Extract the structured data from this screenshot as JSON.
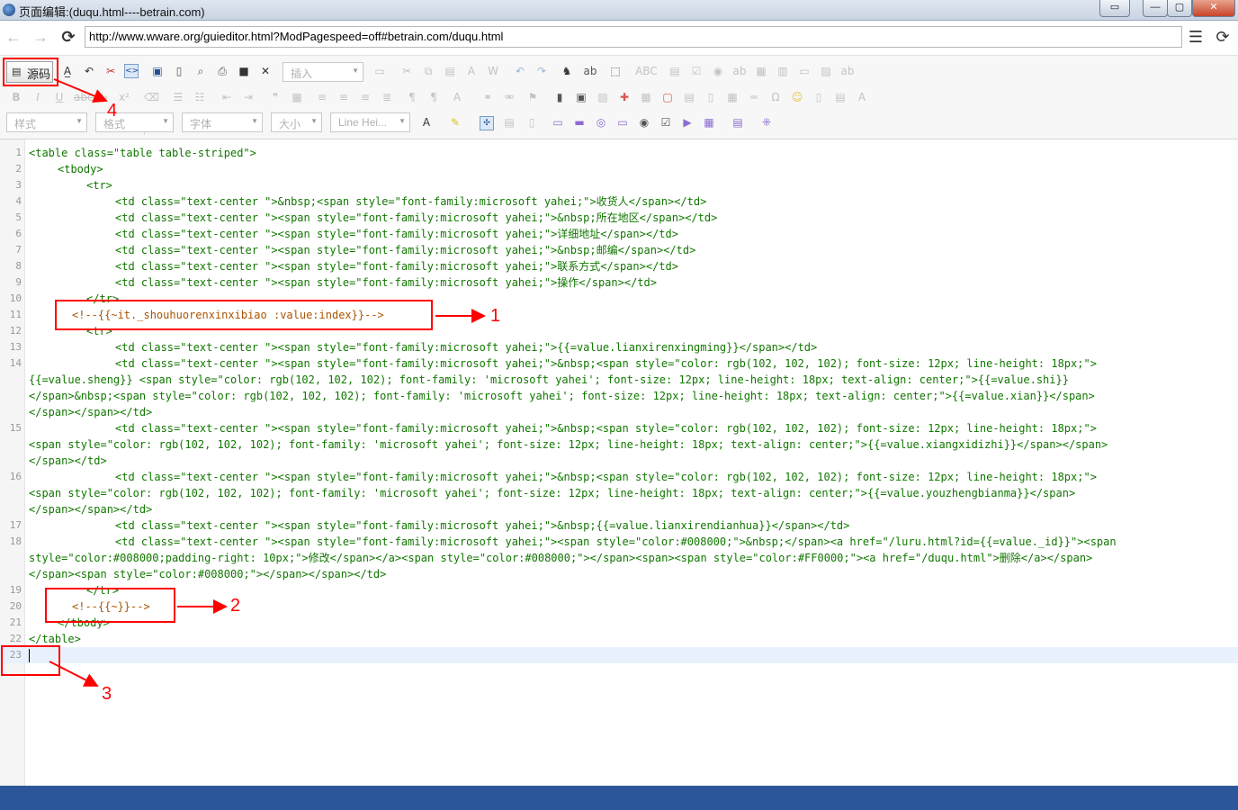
{
  "window": {
    "title": "页面编辑:(duqu.html----betrain.com)",
    "buttons": {
      "restore_back": "▭",
      "minimize": "—",
      "maximize": "▢",
      "close": "✕"
    }
  },
  "nav": {
    "url": "http://www.wware.org/guieditor.html?ModPagespeed=off#betrain.com/duqu.html",
    "back_icon": "←",
    "forward_icon": "→",
    "reload_icon": "⟳",
    "menu_icon": "☰"
  },
  "toolbar": {
    "source_label": "源码",
    "insert_placeholder": "插入",
    "styles_placeholder": "样式",
    "format_placeholder": "格式",
    "font_placeholder": "字体",
    "size_placeholder": "大小",
    "lineheight_placeholder": "Line Hei..."
  },
  "annotations": [
    "1",
    "2",
    "3",
    "4"
  ],
  "code_lines": [
    {
      "n": "1"
    },
    {
      "n": "2"
    },
    {
      "n": "3"
    },
    {
      "n": "4"
    },
    {
      "n": "5"
    },
    {
      "n": "6"
    },
    {
      "n": "7"
    },
    {
      "n": "8"
    },
    {
      "n": "9"
    },
    {
      "n": "10"
    },
    {
      "n": "11"
    },
    {
      "n": "12"
    },
    {
      "n": "13"
    },
    {
      "n": "14"
    },
    {
      "n": "15"
    },
    {
      "n": "16"
    },
    {
      "n": "17"
    },
    {
      "n": "18"
    },
    {
      "n": "19"
    },
    {
      "n": "20"
    },
    {
      "n": "21"
    },
    {
      "n": "22"
    },
    {
      "n": "23"
    }
  ],
  "code": {
    "l1": "<table class=\"table table-striped\">",
    "l2": "<tbody>",
    "l3": "<tr>",
    "l4": "<td class=\"text-center \">&nbsp;<span style=\"font-family:microsoft yahei;\">收货人</span></td>",
    "l5": "<td class=\"text-center \"><span style=\"font-family:microsoft yahei;\">&nbsp;所在地区</span></td>",
    "l6": "<td class=\"text-center \"><span style=\"font-family:microsoft yahei;\">详细地址</span></td>",
    "l7": "<td class=\"text-center \"><span style=\"font-family:microsoft yahei;\">&nbsp;邮编</span></td>",
    "l8": "<td class=\"text-center \"><span style=\"font-family:microsoft yahei;\">联系方式</span></td>",
    "l9": "<td class=\"text-center \"><span style=\"font-family:microsoft yahei;\">操作</span></td>",
    "l10": "</tr>",
    "l11": "<!--{{~it._shouhuorenxinxibiao :value:index}}-->",
    "l12": "<tr>",
    "l13": "<td class=\"text-center \"><span style=\"font-family:microsoft yahei;\">{{=value.lianxirenxingming}}</span></td>",
    "l14a": "<td class=\"text-center \"><span style=\"font-family:microsoft yahei;\">&nbsp;<span style=\"color: rgb(102, 102, 102); font-size: 12px; line-height: 18px;\">",
    "l14b": "{{=value.sheng}} <span style=\"color: rgb(102, 102, 102); font-family: 'microsoft yahei'; font-size: 12px; line-height: 18px; text-align: center;\">{{=value.shi}}",
    "l14c": "</span>&nbsp;<span style=\"color: rgb(102, 102, 102); font-family: 'microsoft yahei'; font-size: 12px; line-height: 18px; text-align: center;\">{{=value.xian}}</span>",
    "l14d": "</span></span></td>",
    "l15a": "<td class=\"text-center \"><span style=\"font-family:microsoft yahei;\">&nbsp;<span style=\"color: rgb(102, 102, 102); font-size: 12px; line-height: 18px;\">",
    "l15b": "<span style=\"color: rgb(102, 102, 102); font-family: 'microsoft yahei'; font-size: 12px; line-height: 18px; text-align: center;\">{{=value.xiangxidizhi}}</span></span>",
    "l15c": "</span></td>",
    "l16a": "<td class=\"text-center \"><span style=\"font-family:microsoft yahei;\">&nbsp;<span style=\"color: rgb(102, 102, 102); font-size: 12px; line-height: 18px;\">",
    "l16b": "<span style=\"color: rgb(102, 102, 102); font-family: 'microsoft yahei'; font-size: 12px; line-height: 18px; text-align: center;\">{{=value.youzhengbianma}}</span>",
    "l16c": "</span></span></td>",
    "l17": "<td class=\"text-center \"><span style=\"font-family:microsoft yahei;\">&nbsp;{{=value.lianxirendianhua}}</span></td>",
    "l18a": "<td class=\"text-center \"><span style=\"font-family:microsoft yahei;\"><span style=\"color:#008000;\">&nbsp;</span><a href=\"/luru.html?id={{=value._id}}\"><span",
    "l18b": "style=\"color:#008000;padding-right: 10px;\">修改</span></a><span style=\"color:#008000;\"></span><span><span style=\"color:#FF0000;\"><a href=\"/duqu.html\">删除</a></span>",
    "l18c": "</span><span style=\"color:#008000;\"></span></span></td>",
    "l19": "</tr>",
    "l20": "<!--{{~}}-->",
    "l21": "</tbody>",
    "l22": "</table>",
    "l23": ""
  },
  "colors": {
    "statusbar": "#2b579a",
    "annotation": "#ff0000",
    "tag": "#117700",
    "attr": "#0000cc",
    "string": "#aa1111",
    "comment": "#aa5500"
  }
}
